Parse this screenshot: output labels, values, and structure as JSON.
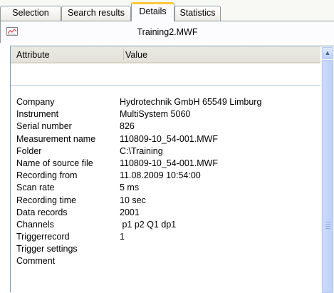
{
  "tabs": [
    {
      "label": "Selection"
    },
    {
      "label": "Search results"
    },
    {
      "label": "Details"
    },
    {
      "label": "Statistics"
    }
  ],
  "active_tab": "Details",
  "file": {
    "name": "Training2.MWF",
    "icon": "line-chart-icon"
  },
  "table": {
    "columns": [
      "Attribute",
      "Value"
    ],
    "rows": [
      {
        "attribute": "Company",
        "value": "Hydrotechnik GmbH 65549 Limburg"
      },
      {
        "attribute": "Instrument",
        "value": "MultiSystem 5060"
      },
      {
        "attribute": "Serial number",
        "value": "826"
      },
      {
        "attribute": "Measurement name",
        "value": "110809-10_54-001.MWF"
      },
      {
        "attribute": "Folder",
        "value": "C:\\Training"
      },
      {
        "attribute": "Name of source file",
        "value": "110809-10_54-001.MWF"
      },
      {
        "attribute": "Recording from",
        "value": "11.08.2009 10:54:00"
      },
      {
        "attribute": "Scan rate",
        "value": "5 ms"
      },
      {
        "attribute": "Recording time",
        "value": "10 sec"
      },
      {
        "attribute": "Data records",
        "value": "2001"
      },
      {
        "attribute": "Channels",
        "value": " p1 p2 Q1 dp1"
      },
      {
        "attribute": "Triggerrecord",
        "value": "1"
      },
      {
        "attribute": "Trigger settings",
        "value": ""
      },
      {
        "attribute": "Comment",
        "value": ""
      }
    ]
  },
  "scrollbar": {
    "up_arrow": "chevron-up-icon"
  },
  "colors": {
    "active_tab_accent": "#ffc83c",
    "header_bg": "#ebeae2",
    "scrollbar_thumb": "#c3d3fd"
  }
}
